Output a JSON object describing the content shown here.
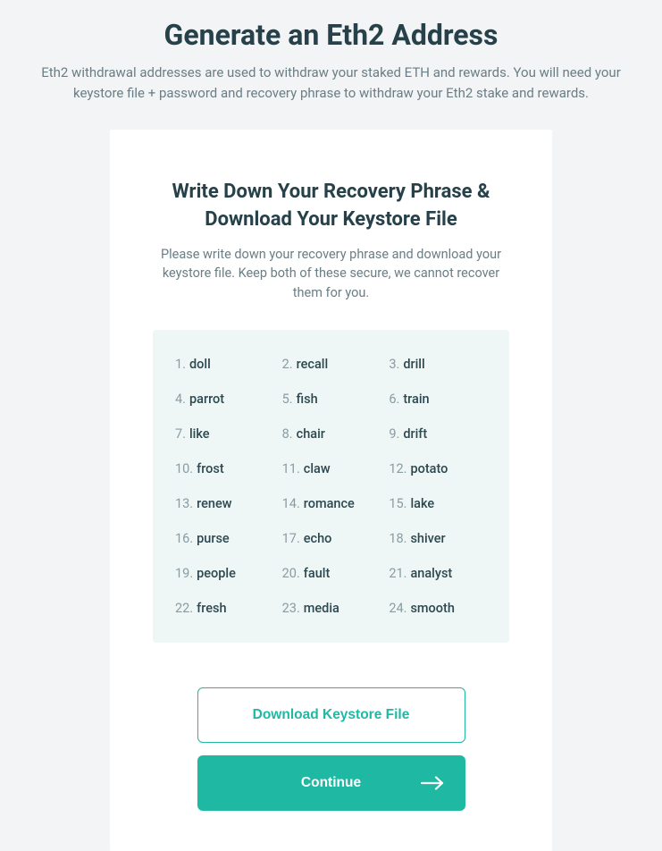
{
  "header": {
    "title": "Generate an Eth2 Address",
    "subtitle": "Eth2 withdrawal addresses are used to withdraw your staked ETH and rewards. You will need your keystore file + password and recovery phrase to withdraw your Eth2 stake and rewards."
  },
  "card": {
    "title_line1": "Write Down Your Recovery Phrase &",
    "title_line2": "Download Your Keystore File",
    "description": "Please write down your recovery phrase and download your keystore file. Keep both of these secure, we cannot recover them for you."
  },
  "phrase": {
    "words": [
      {
        "num": "1.",
        "word": "doll"
      },
      {
        "num": "2.",
        "word": "recall"
      },
      {
        "num": "3.",
        "word": "drill"
      },
      {
        "num": "4.",
        "word": "parrot"
      },
      {
        "num": "5.",
        "word": "fish"
      },
      {
        "num": "6.",
        "word": "train"
      },
      {
        "num": "7.",
        "word": "like"
      },
      {
        "num": "8.",
        "word": "chair"
      },
      {
        "num": "9.",
        "word": "drift"
      },
      {
        "num": "10.",
        "word": "frost"
      },
      {
        "num": "11.",
        "word": "claw"
      },
      {
        "num": "12.",
        "word": "potato"
      },
      {
        "num": "13.",
        "word": "renew"
      },
      {
        "num": "14.",
        "word": "romance"
      },
      {
        "num": "15.",
        "word": "lake"
      },
      {
        "num": "16.",
        "word": "purse"
      },
      {
        "num": "17.",
        "word": "echo"
      },
      {
        "num": "18.",
        "word": "shiver"
      },
      {
        "num": "19.",
        "word": "people"
      },
      {
        "num": "20.",
        "word": "fault"
      },
      {
        "num": "21.",
        "word": "analyst"
      },
      {
        "num": "22.",
        "word": "fresh"
      },
      {
        "num": "23.",
        "word": "media"
      },
      {
        "num": "24.",
        "word": "smooth"
      }
    ]
  },
  "buttons": {
    "download": "Download Keystore File",
    "continue": "Continue"
  }
}
